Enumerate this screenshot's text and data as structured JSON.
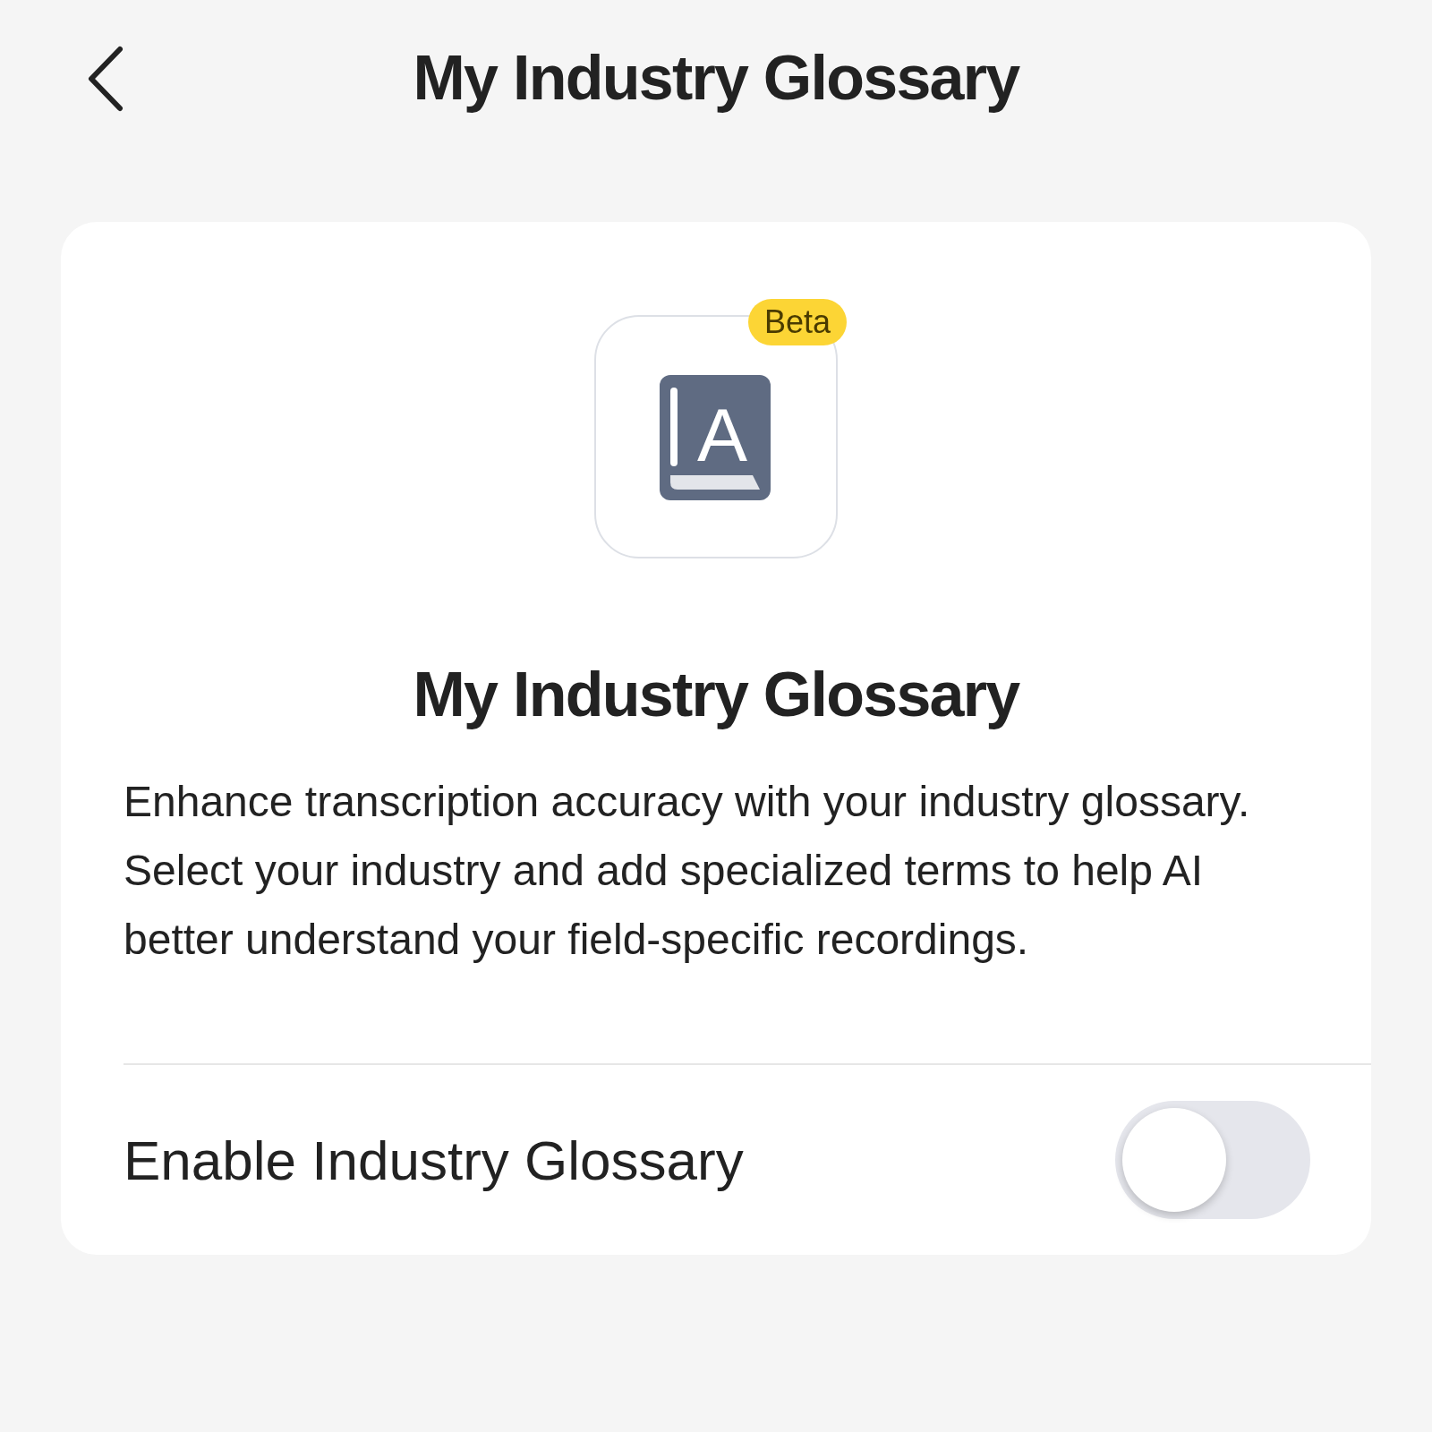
{
  "header": {
    "title": "My Industry Glossary"
  },
  "feature": {
    "badge": "Beta",
    "icon_letter": "A",
    "title": "My Industry Glossary",
    "description": "Enhance transcription accuracy with your industry glossary. Select your industry and add specialized terms to help AI better understand your field-specific recordings."
  },
  "toggle": {
    "label": "Enable Industry Glossary",
    "on": false
  }
}
